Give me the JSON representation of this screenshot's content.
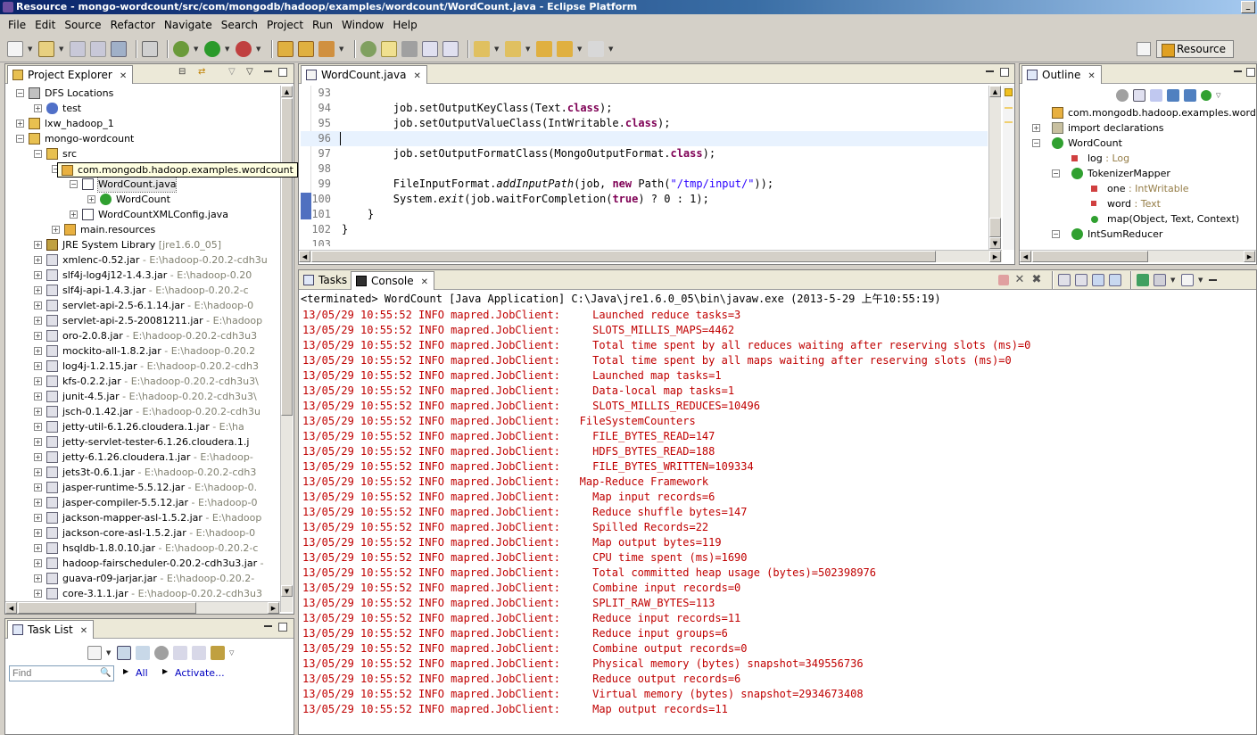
{
  "window": {
    "title": "Resource - mongo-wordcount/src/com/mongodb/hadoop/examples/wordcount/WordCount.java - Eclipse Platform"
  },
  "menu": [
    "File",
    "Edit",
    "Source",
    "Refactor",
    "Navigate",
    "Search",
    "Project",
    "Run",
    "Window",
    "Help"
  ],
  "perspective": {
    "label": "Resource"
  },
  "project_explorer": {
    "tab_label": "Project Explorer",
    "tooltip": "com.mongodb.hadoop.examples.wordcount",
    "items": [
      {
        "label": "DFS Locations",
        "depth": 0,
        "toggle": "−",
        "icon": "dfs-icon"
      },
      {
        "label": "test",
        "depth": 1,
        "toggle": "+",
        "icon": "elephant-icon"
      },
      {
        "label": "lxw_hadoop_1",
        "depth": 0,
        "toggle": "+",
        "icon": "project-icon"
      },
      {
        "label": "mongo-wordcount",
        "depth": 0,
        "toggle": "−",
        "icon": "project-icon"
      },
      {
        "label": "src",
        "depth": 1,
        "toggle": "−",
        "icon": "source-folder-icon"
      },
      {
        "label": "com.mongodb.hadoop.examples.wordcount",
        "depth": 2,
        "toggle": "−",
        "icon": "package-icon"
      },
      {
        "label": "WordCount.java",
        "depth": 3,
        "toggle": "−",
        "icon": "java-file-icon",
        "selected": true
      },
      {
        "label": "WordCount",
        "depth": 4,
        "toggle": "+",
        "icon": "class-icon"
      },
      {
        "label": "WordCountXMLConfig.java",
        "depth": 3,
        "toggle": "+",
        "icon": "java-file-icon"
      },
      {
        "label": "main.resources",
        "depth": 2,
        "toggle": "+",
        "icon": "package-icon"
      },
      {
        "label": "JRE System Library",
        "suffix": "[jre1.6.0_05]",
        "depth": 1,
        "toggle": "+",
        "icon": "library-icon"
      },
      {
        "label": "xmlenc-0.52.jar",
        "suffix": "- E:\\hadoop-0.20.2-cdh3u",
        "depth": 1,
        "toggle": "+",
        "icon": "jar-icon"
      },
      {
        "label": "slf4j-log4j12-1.4.3.jar",
        "suffix": "- E:\\hadoop-0.20",
        "depth": 1,
        "toggle": "+",
        "icon": "jar-icon"
      },
      {
        "label": "slf4j-api-1.4.3.jar",
        "suffix": "- E:\\hadoop-0.20.2-c",
        "depth": 1,
        "toggle": "+",
        "icon": "jar-icon"
      },
      {
        "label": "servlet-api-2.5-6.1.14.jar",
        "suffix": "- E:\\hadoop-0",
        "depth": 1,
        "toggle": "+",
        "icon": "jar-icon"
      },
      {
        "label": "servlet-api-2.5-20081211.jar",
        "suffix": "- E:\\hadoop",
        "depth": 1,
        "toggle": "+",
        "icon": "jar-icon"
      },
      {
        "label": "oro-2.0.8.jar",
        "suffix": "- E:\\hadoop-0.20.2-cdh3u3",
        "depth": 1,
        "toggle": "+",
        "icon": "jar-icon"
      },
      {
        "label": "mockito-all-1.8.2.jar",
        "suffix": "- E:\\hadoop-0.20.2",
        "depth": 1,
        "toggle": "+",
        "icon": "jar-icon"
      },
      {
        "label": "log4j-1.2.15.jar",
        "suffix": "- E:\\hadoop-0.20.2-cdh3",
        "depth": 1,
        "toggle": "+",
        "icon": "jar-icon"
      },
      {
        "label": "kfs-0.2.2.jar",
        "suffix": "- E:\\hadoop-0.20.2-cdh3u3\\",
        "depth": 1,
        "toggle": "+",
        "icon": "jar-icon"
      },
      {
        "label": "junit-4.5.jar",
        "suffix": "- E:\\hadoop-0.20.2-cdh3u3\\",
        "depth": 1,
        "toggle": "+",
        "icon": "jar-icon"
      },
      {
        "label": "jsch-0.1.42.jar",
        "suffix": "- E:\\hadoop-0.20.2-cdh3u",
        "depth": 1,
        "toggle": "+",
        "icon": "jar-icon"
      },
      {
        "label": "jetty-util-6.1.26.cloudera.1.jar",
        "suffix": "- E:\\ha",
        "depth": 1,
        "toggle": "+",
        "icon": "jar-icon"
      },
      {
        "label": "jetty-servlet-tester-6.1.26.cloudera.1.j",
        "suffix": "",
        "depth": 1,
        "toggle": "+",
        "icon": "jar-icon"
      },
      {
        "label": "jetty-6.1.26.cloudera.1.jar",
        "suffix": "- E:\\hadoop-",
        "depth": 1,
        "toggle": "+",
        "icon": "jar-icon"
      },
      {
        "label": "jets3t-0.6.1.jar",
        "suffix": "- E:\\hadoop-0.20.2-cdh3",
        "depth": 1,
        "toggle": "+",
        "icon": "jar-icon"
      },
      {
        "label": "jasper-runtime-5.5.12.jar",
        "suffix": "- E:\\hadoop-0.",
        "depth": 1,
        "toggle": "+",
        "icon": "jar-icon"
      },
      {
        "label": "jasper-compiler-5.5.12.jar",
        "suffix": "- E:\\hadoop-0",
        "depth": 1,
        "toggle": "+",
        "icon": "jar-icon"
      },
      {
        "label": "jackson-mapper-asl-1.5.2.jar",
        "suffix": "- E:\\hadoop",
        "depth": 1,
        "toggle": "+",
        "icon": "jar-icon"
      },
      {
        "label": "jackson-core-asl-1.5.2.jar",
        "suffix": "- E:\\hadoop-0",
        "depth": 1,
        "toggle": "+",
        "icon": "jar-icon"
      },
      {
        "label": "hsqldb-1.8.0.10.jar",
        "suffix": "- E:\\hadoop-0.20.2-c",
        "depth": 1,
        "toggle": "+",
        "icon": "jar-icon"
      },
      {
        "label": "hadoop-fairscheduler-0.20.2-cdh3u3.jar",
        "suffix": "-",
        "depth": 1,
        "toggle": "+",
        "icon": "jar-icon"
      },
      {
        "label": "guava-r09-jarjar.jar",
        "suffix": "- E:\\hadoop-0.20.2-",
        "depth": 1,
        "toggle": "+",
        "icon": "jar-icon"
      },
      {
        "label": "core-3.1.1.jar",
        "suffix": "- E:\\hadoop-0.20.2-cdh3u3",
        "depth": 1,
        "toggle": "+",
        "icon": "jar-icon"
      }
    ]
  },
  "task_list": {
    "tab_label": "Task List",
    "find_placeholder": "Find",
    "all_label": "All",
    "activate_label": "Activate..."
  },
  "editor": {
    "tab_label": "WordCount.java",
    "lines": [
      {
        "n": "93",
        "segs": []
      },
      {
        "n": "94",
        "segs": [
          [
            "",
            "        job.setOutputKeyClass(Text."
          ],
          [
            "kw",
            "class"
          ],
          [
            "",
            ");"
          ]
        ]
      },
      {
        "n": "95",
        "segs": [
          [
            "",
            "        job.setOutputValueClass(IntWritable."
          ],
          [
            "kw",
            "class"
          ],
          [
            "",
            ");"
          ]
        ]
      },
      {
        "n": "96",
        "segs": [],
        "current": true
      },
      {
        "n": "97",
        "segs": [
          [
            "",
            "        job.setOutputFormatClass(MongoOutputFormat."
          ],
          [
            "kw",
            "class"
          ],
          [
            "",
            ");"
          ]
        ]
      },
      {
        "n": "98",
        "segs": []
      },
      {
        "n": "99",
        "segs": [
          [
            "",
            "        FileInputFormat."
          ],
          [
            "it",
            "addInputPath"
          ],
          [
            "",
            "(job, "
          ],
          [
            "kw",
            "new"
          ],
          [
            "",
            " Path("
          ],
          [
            "str",
            "\"/tmp/input/\""
          ],
          [
            "",
            "));"
          ]
        ]
      },
      {
        "n": "100",
        "segs": [
          [
            "",
            "        System."
          ],
          [
            "it",
            "exit"
          ],
          [
            "",
            "(job.waitForCompletion("
          ],
          [
            "kw",
            "true"
          ],
          [
            "",
            ") ? 0 : 1);"
          ]
        ]
      },
      {
        "n": "101",
        "segs": [
          [
            "",
            "    }"
          ]
        ]
      },
      {
        "n": "102",
        "segs": [
          [
            "",
            "}"
          ]
        ]
      },
      {
        "n": "103",
        "segs": []
      }
    ]
  },
  "outline": {
    "tab_label": "Outline",
    "items": [
      {
        "label": "com.mongodb.hadoop.examples.wordcou",
        "depth": 0,
        "toggle": "",
        "icon": "package-icon"
      },
      {
        "label": "import declarations",
        "depth": 0,
        "toggle": "+",
        "icon": "import-icon"
      },
      {
        "label": "WordCount",
        "depth": 0,
        "toggle": "−",
        "icon": "class-icon"
      },
      {
        "label": "log",
        "type": ": Log",
        "depth": 1,
        "toggle": "",
        "icon": "static-field-icon"
      },
      {
        "label": "TokenizerMapper",
        "depth": 1,
        "toggle": "−",
        "icon": "inner-class-icon"
      },
      {
        "label": "one",
        "type": ": IntWritable",
        "depth": 2,
        "toggle": "",
        "icon": "static-field-icon"
      },
      {
        "label": "word",
        "type": ": Text",
        "depth": 2,
        "toggle": "",
        "icon": "field-icon"
      },
      {
        "label": "map(Object, Text, Context)",
        "type": "",
        "depth": 2,
        "toggle": "",
        "icon": "method-icon"
      },
      {
        "label": "IntSumReducer",
        "depth": 1,
        "toggle": "−",
        "icon": "inner-class-icon"
      }
    ]
  },
  "bottom": {
    "tasks_tab": "Tasks",
    "console_tab": "Console",
    "status": "<terminated> WordCount [Java Application] C:\\Java\\jre1.6.0_05\\bin\\javaw.exe (2013-5-29 上午10:55:19)",
    "prefix": "13/05/29 10:55:52 INFO mapred.JobClient:",
    "lines": [
      "    Launched reduce tasks=3",
      "    SLOTS_MILLIS_MAPS=4462",
      "    Total time spent by all reduces waiting after reserving slots (ms)=0",
      "    Total time spent by all maps waiting after reserving slots (ms)=0",
      "    Launched map tasks=1",
      "    Data-local map tasks=1",
      "    SLOTS_MILLIS_REDUCES=10496",
      "  FileSystemCounters",
      "    FILE_BYTES_READ=147",
      "    HDFS_BYTES_READ=188",
      "    FILE_BYTES_WRITTEN=109334",
      "  Map-Reduce Framework",
      "    Map input records=6",
      "    Reduce shuffle bytes=147",
      "    Spilled Records=22",
      "    Map output bytes=119",
      "    CPU time spent (ms)=1690",
      "    Total committed heap usage (bytes)=502398976",
      "    Combine input records=0",
      "    SPLIT_RAW_BYTES=113",
      "    Reduce input records=11",
      "    Reduce input groups=6",
      "    Combine output records=0",
      "    Physical memory (bytes) snapshot=349556736",
      "    Reduce output records=6",
      "    Virtual memory (bytes) snapshot=2934673408",
      "    Map output records=11"
    ]
  }
}
